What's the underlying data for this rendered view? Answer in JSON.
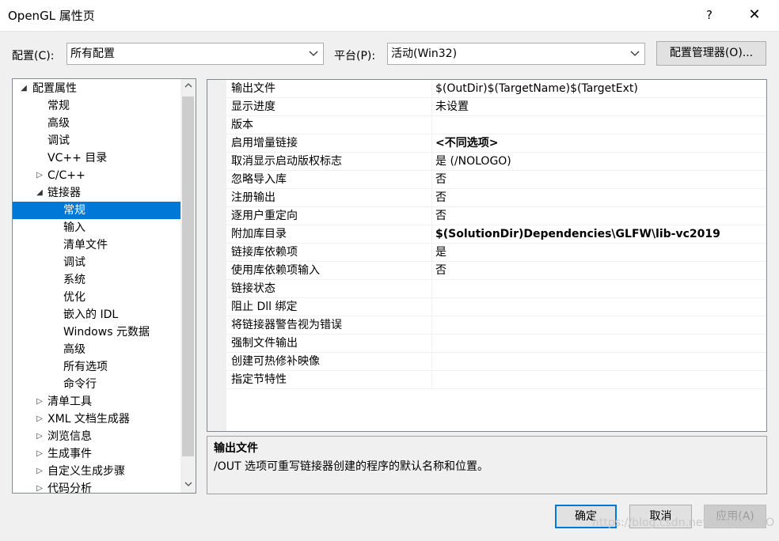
{
  "window": {
    "title": "OpenGL 属性页",
    "help_glyph": "?",
    "close_glyph": "✕"
  },
  "toolbar": {
    "config_label": "配置(C):",
    "config_value": "所有配置",
    "platform_label": "平台(P):",
    "platform_value": "活动(Win32)",
    "config_manager_label": "配置管理器(O)..."
  },
  "tree": {
    "items": [
      {
        "label": "配置属性",
        "toggle": "◢"
      },
      {
        "label": "常规"
      },
      {
        "label": "高级"
      },
      {
        "label": "调试"
      },
      {
        "label": "VC++ 目录"
      },
      {
        "label": "C/C++",
        "toggle": "▷"
      },
      {
        "label": "链接器",
        "toggle": "◢"
      },
      {
        "label": "常规",
        "selected": true
      },
      {
        "label": "输入"
      },
      {
        "label": "清单文件"
      },
      {
        "label": "调试"
      },
      {
        "label": "系统"
      },
      {
        "label": "优化"
      },
      {
        "label": "嵌入的 IDL"
      },
      {
        "label": "Windows 元数据"
      },
      {
        "label": "高级"
      },
      {
        "label": "所有选项"
      },
      {
        "label": "命令行"
      },
      {
        "label": "清单工具",
        "toggle": "▷"
      },
      {
        "label": "XML 文档生成器",
        "toggle": "▷"
      },
      {
        "label": "浏览信息",
        "toggle": "▷"
      },
      {
        "label": "生成事件",
        "toggle": "▷"
      },
      {
        "label": "自定义生成步骤",
        "toggle": "▷"
      },
      {
        "label": "代码分析",
        "toggle": "▷"
      }
    ]
  },
  "properties": [
    {
      "name": "输出文件",
      "value": "$(OutDir)$(TargetName)$(TargetExt)"
    },
    {
      "name": "显示进度",
      "value": "未设置"
    },
    {
      "name": "版本",
      "value": ""
    },
    {
      "name": "启用增量链接",
      "value": "<不同选项>",
      "bold": true
    },
    {
      "name": "取消显示启动版权标志",
      "value": "是 (/NOLOGO)"
    },
    {
      "name": "忽略导入库",
      "value": "否"
    },
    {
      "name": "注册输出",
      "value": "否"
    },
    {
      "name": "逐用户重定向",
      "value": "否"
    },
    {
      "name": "附加库目录",
      "value": "$(SolutionDir)Dependencies\\GLFW\\lib-vc2019",
      "bold": true
    },
    {
      "name": "链接库依赖项",
      "value": "是"
    },
    {
      "name": "使用库依赖项输入",
      "value": "否"
    },
    {
      "name": "链接状态",
      "value": ""
    },
    {
      "name": "阻止 Dll 绑定",
      "value": ""
    },
    {
      "name": "将链接器警告视为错误",
      "value": ""
    },
    {
      "name": "强制文件输出",
      "value": ""
    },
    {
      "name": "创建可热修补映像",
      "value": ""
    },
    {
      "name": "指定节特性",
      "value": ""
    }
  ],
  "description": {
    "title": "输出文件",
    "body": "/OUT 选项可重写链接器创建的程序的默认名称和位置。"
  },
  "buttons": {
    "ok": "确定",
    "cancel": "取消",
    "apply": "应用(A)"
  },
  "watermark": "https://blog.csdn.net/OBigBangO"
}
